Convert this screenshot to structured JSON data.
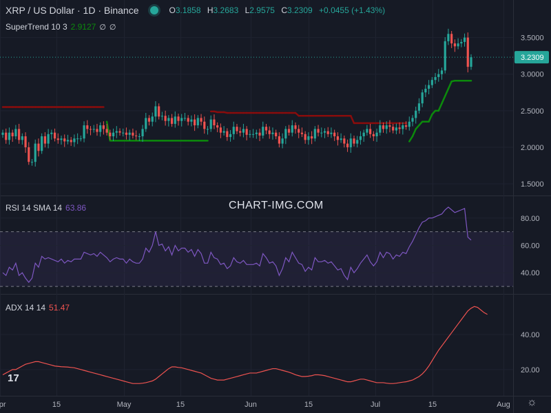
{
  "header": {
    "symbol_title": "XRP / US Dollar · 1D · Binance",
    "ohlc": [
      {
        "key": "O",
        "value": "3.1858"
      },
      {
        "key": "H",
        "value": "3.2683"
      },
      {
        "key": "L",
        "value": "2.9575"
      },
      {
        "key": "C",
        "value": "3.2309"
      }
    ],
    "change": "+0.0455 (+1.43%)",
    "status_color": "#26a69a"
  },
  "watermark": "CHART-IMG.COM",
  "logo_text": "17",
  "colors": {
    "up": "#26a69a",
    "down": "#ef5350",
    "supertrend_up": "#0c8a0c",
    "supertrend_down": "#8a0c0c",
    "rsi": "#7e57c2",
    "adx": "#ef5350",
    "background": "#161a25"
  },
  "chart_data": [
    {
      "type": "candlestick",
      "title": "XRP / US Dollar · 1D · Binance",
      "x_tick_labels": [
        "Apr",
        "15",
        "May",
        "15",
        "Jun",
        "15",
        "Jul",
        "15",
        "Aug"
      ],
      "ylim": [
        1.35,
        3.75
      ],
      "y_ticks": [
        1.5,
        2.0,
        2.5,
        3.0,
        3.5
      ],
      "y_tick_labels": [
        "1.5000",
        "2.0000",
        "2.5000",
        "3.0000",
        "3.5000"
      ],
      "last_price_label": "3.2309",
      "last_price": 3.2309,
      "grid": true,
      "closes": [
        2.2,
        2.1,
        2.2,
        2.15,
        2.25,
        2.1,
        2.15,
        2.0,
        1.8,
        1.8,
        2.05,
        1.95,
        2.15,
        2.05,
        2.18,
        2.2,
        2.12,
        2.1,
        2.12,
        2.08,
        2.1,
        2.07,
        2.12,
        2.12,
        2.12,
        2.3,
        2.25,
        2.24,
        2.25,
        2.21,
        2.3,
        2.25,
        2.2,
        2.15,
        2.2,
        2.22,
        2.2,
        2.2,
        2.17,
        2.2,
        2.16,
        2.15,
        2.15,
        2.25,
        2.4,
        2.35,
        2.42,
        2.56,
        2.42,
        2.43,
        2.36,
        2.4,
        2.32,
        2.42,
        2.36,
        2.4,
        2.4,
        2.35,
        2.38,
        2.3,
        2.4,
        2.35,
        2.25,
        2.25,
        2.38,
        2.3,
        2.27,
        2.2,
        2.22,
        2.14,
        2.18,
        2.28,
        2.22,
        2.2,
        2.25,
        2.17,
        2.18,
        2.18,
        2.2,
        2.16,
        2.28,
        2.23,
        2.18,
        2.2,
        2.15,
        2.05,
        2.12,
        2.25,
        2.2,
        2.3,
        2.25,
        2.2,
        2.18,
        2.1,
        2.15,
        2.12,
        2.25,
        2.2,
        2.2,
        2.22,
        2.18,
        2.2,
        2.15,
        2.1,
        2.12,
        2.05,
        2.0,
        2.12,
        2.05,
        2.1,
        2.15,
        2.2,
        2.25,
        2.18,
        2.15,
        2.2,
        2.3,
        2.25,
        2.3,
        2.28,
        2.23,
        2.27,
        2.25,
        2.3,
        2.28,
        2.35,
        2.4,
        2.5,
        2.6,
        2.75,
        2.8,
        2.85,
        2.92,
        2.96,
        3.0,
        3.05,
        3.45,
        3.55,
        3.42,
        3.38,
        3.42,
        3.44,
        3.5,
        3.1,
        3.2309
      ],
      "candles_note": "values read off the price axis; opens are the prior close",
      "supertrend": {
        "label": "SuperTrend 10 3",
        "value_label": "2.9127",
        "values": [
          2.55,
          2.55,
          2.55,
          2.55,
          2.55,
          2.55,
          2.55,
          2.55,
          2.55,
          2.55,
          2.55,
          2.55,
          2.55,
          2.55,
          2.55,
          2.55,
          2.55,
          2.55,
          2.55,
          2.55,
          2.55,
          2.55,
          2.55,
          2.55,
          2.55,
          2.55,
          2.55,
          2.55,
          2.55,
          2.55,
          2.55,
          2.55,
          2.35,
          2.09,
          2.09,
          2.09,
          2.09,
          2.09,
          2.09,
          2.09,
          2.09,
          2.09,
          2.09,
          2.09,
          2.09,
          2.09,
          2.09,
          2.09,
          2.09,
          2.09,
          2.09,
          2.09,
          2.09,
          2.09,
          2.09,
          2.09,
          2.09,
          2.09,
          2.09,
          2.09,
          2.09,
          2.09,
          2.09,
          2.09,
          2.49,
          2.49,
          2.48,
          2.48,
          2.48,
          2.47,
          2.47,
          2.47,
          2.47,
          2.47,
          2.47,
          2.47,
          2.47,
          2.47,
          2.47,
          2.47,
          2.47,
          2.47,
          2.47,
          2.47,
          2.47,
          2.47,
          2.47,
          2.47,
          2.47,
          2.47,
          2.47,
          2.43,
          2.43,
          2.43,
          2.43,
          2.43,
          2.43,
          2.43,
          2.43,
          2.43,
          2.43,
          2.43,
          2.43,
          2.43,
          2.43,
          2.43,
          2.43,
          2.43,
          2.33,
          2.33,
          2.33,
          2.33,
          2.33,
          2.33,
          2.33,
          2.33,
          2.33,
          2.33,
          2.33,
          2.33,
          2.33,
          2.33,
          2.33,
          2.33,
          2.33,
          2.08,
          2.15,
          2.25,
          2.3,
          2.35,
          2.35,
          2.35,
          2.45,
          2.5,
          2.5,
          2.6,
          2.7,
          2.8,
          2.9,
          2.91,
          2.91,
          2.91,
          2.91,
          2.91,
          2.91,
          2.91,
          2.9127
        ],
        "trend": [
          "down",
          "down",
          "down",
          "down",
          "down",
          "down",
          "down",
          "down",
          "down",
          "down",
          "down",
          "down",
          "down",
          "down",
          "down",
          "down",
          "down",
          "down",
          "down",
          "down",
          "down",
          "down",
          "down",
          "down",
          "down",
          "down",
          "down",
          "down",
          "down",
          "down",
          "down",
          "down",
          "up",
          "up",
          "up",
          "up",
          "up",
          "up",
          "up",
          "up",
          "up",
          "up",
          "up",
          "up",
          "up",
          "up",
          "up",
          "up",
          "up",
          "up",
          "up",
          "up",
          "up",
          "up",
          "up",
          "up",
          "up",
          "up",
          "up",
          "up",
          "up",
          "up",
          "up",
          "up",
          "down",
          "down",
          "down",
          "down",
          "down",
          "down",
          "down",
          "down",
          "down",
          "down",
          "down",
          "down",
          "down",
          "down",
          "down",
          "down",
          "down",
          "down",
          "down",
          "down",
          "down",
          "down",
          "down",
          "down",
          "down",
          "down",
          "down",
          "down",
          "down",
          "down",
          "down",
          "down",
          "down",
          "down",
          "down",
          "down",
          "down",
          "down",
          "down",
          "down",
          "down",
          "down",
          "down",
          "down",
          "down",
          "down",
          "down",
          "down",
          "down",
          "down",
          "down",
          "down",
          "down",
          "down",
          "down",
          "down",
          "down",
          "down",
          "down",
          "down",
          "down",
          "up",
          "up",
          "up",
          "up",
          "up",
          "up",
          "up",
          "up",
          "up",
          "up",
          "up",
          "up",
          "up",
          "up",
          "up",
          "up",
          "up",
          "up",
          "up",
          "up",
          "up",
          "up",
          "up"
        ]
      }
    },
    {
      "type": "line",
      "name": "RSI 14 SMA 14",
      "value_label": "63.86",
      "ylim": [
        25,
        95
      ],
      "y_ticks": [
        40,
        60,
        80
      ],
      "y_tick_labels": [
        "40.00",
        "60.00",
        "80.00"
      ],
      "band": [
        30,
        70
      ],
      "values": [
        40,
        38,
        44,
        42,
        47,
        38,
        40,
        36,
        33,
        36,
        47,
        44,
        52,
        50,
        51,
        50,
        49,
        48,
        50,
        47,
        49,
        48,
        50,
        50,
        50,
        55,
        54,
        53,
        54,
        52,
        55,
        53,
        51,
        48,
        50,
        51,
        50,
        50,
        47,
        50,
        48,
        47,
        47,
        50,
        58,
        55,
        60,
        70,
        60,
        61,
        56,
        59,
        53,
        60,
        56,
        58,
        58,
        55,
        57,
        52,
        57,
        54,
        47,
        47,
        55,
        51,
        50,
        46,
        47,
        43,
        45,
        51,
        48,
        47,
        49,
        46,
        46,
        46,
        47,
        45,
        54,
        51,
        47,
        48,
        45,
        38,
        43,
        51,
        48,
        55,
        51,
        47,
        46,
        41,
        44,
        42,
        51,
        48,
        48,
        49,
        47,
        48,
        45,
        42,
        43,
        38,
        35,
        44,
        40,
        43,
        47,
        50,
        53,
        48,
        45,
        48,
        55,
        51,
        55,
        54,
        50,
        53,
        52,
        55,
        54,
        59,
        63,
        68,
        73,
        77,
        78,
        80,
        80,
        81,
        82,
        83,
        86,
        88,
        86,
        84,
        85,
        86,
        87,
        66,
        63.86
      ]
    },
    {
      "type": "line",
      "name": "ADX 14 14",
      "value_label": "51.47",
      "ylim": [
        5,
        62
      ],
      "y_ticks": [
        20,
        40
      ],
      "y_tick_labels": [
        "20.00",
        "40.00"
      ],
      "values": [
        17,
        18,
        19,
        20,
        20,
        21,
        22,
        23,
        23.5,
        24,
        24.5,
        24.5,
        24,
        23.5,
        23,
        22.5,
        22,
        21.8,
        21.6,
        21.5,
        21.4,
        21.2,
        21,
        20.5,
        20,
        19.5,
        19,
        18.5,
        18,
        17.5,
        17,
        16.5,
        16,
        15.5,
        15,
        14.5,
        14,
        13.5,
        13,
        12.5,
        12,
        12,
        12,
        12.2,
        12.5,
        13,
        13.5,
        14.5,
        16,
        17.5,
        19,
        20.5,
        21.5,
        21.5,
        21.2,
        21,
        20.5,
        20,
        19.5,
        19,
        18.5,
        18,
        17,
        16,
        15,
        14.5,
        14,
        14,
        14,
        14.5,
        15,
        15.5,
        16,
        16.5,
        17,
        17.5,
        18,
        18,
        18,
        18.5,
        19,
        19.5,
        20,
        20.5,
        20.5,
        20,
        19.5,
        19,
        18.5,
        17.8,
        17,
        16.5,
        16,
        16,
        16.2,
        16.5,
        17,
        17,
        16.8,
        16.5,
        16,
        15.5,
        15,
        14.5,
        14,
        13.5,
        13,
        13,
        13.5,
        14,
        14.5,
        14.5,
        14,
        13.5,
        13,
        12.5,
        12.5,
        12.5,
        12.2,
        12,
        12,
        12.2,
        12.5,
        12.8,
        13,
        13.5,
        14,
        15,
        16,
        17.5,
        19.5,
        22,
        25,
        28,
        31,
        33.5,
        36,
        38.5,
        41,
        43.5,
        46,
        48.5,
        51,
        53.5,
        55,
        56,
        55.5,
        54,
        52.5,
        51.47
      ]
    }
  ],
  "panes": {
    "supertrend_label": "SuperTrend 10 3",
    "supertrend_value": "2.9127",
    "rsi_label": "RSI 14 SMA 14",
    "rsi_value": "63.86",
    "adx_label": "ADX 14 14",
    "adx_value": "51.47"
  },
  "icons": [
    "tradingview-logo-icon",
    "eye-slash-icon",
    "settings-gear-icon"
  ]
}
